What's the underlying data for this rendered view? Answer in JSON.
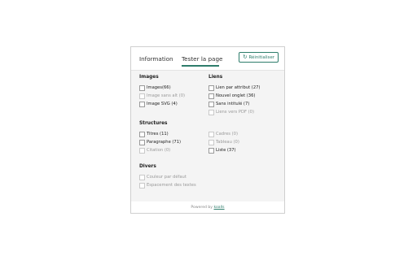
{
  "header": {
    "tabs": [
      {
        "label": "Information"
      },
      {
        "label": "Tester la page"
      }
    ],
    "reset_label": "Réinitialiser"
  },
  "sections": {
    "images": {
      "title": "Images",
      "items": [
        {
          "label": "Images(66)",
          "disabled": false
        },
        {
          "label": "Image sans alt (0)",
          "disabled": true
        },
        {
          "label": "Image SVG (4)",
          "disabled": false
        }
      ]
    },
    "liens": {
      "title": "Liens",
      "items": [
        {
          "label": "Lien par attribut (27)",
          "disabled": false
        },
        {
          "label": "Nouvel onglet (36)",
          "disabled": false
        },
        {
          "label": "Sans intitulé (7)",
          "disabled": false
        },
        {
          "label": "Liens vers PDF (0)",
          "disabled": true
        }
      ]
    },
    "structures": {
      "title": "Structures",
      "items_left": [
        {
          "label": "Titres (11)",
          "disabled": false
        },
        {
          "label": "Paragraphe (71)",
          "disabled": false
        },
        {
          "label": "Citation (0)",
          "disabled": true
        }
      ],
      "items_right": [
        {
          "label": "Cadres (0)",
          "disabled": true
        },
        {
          "label": "Tableau (0)",
          "disabled": true
        },
        {
          "label": "Liste (37)",
          "disabled": false
        }
      ]
    },
    "divers": {
      "title": "Divers",
      "items": [
        {
          "label": "Couleur par défaut",
          "disabled": true
        },
        {
          "label": "Espacement des textes",
          "disabled": true
        }
      ]
    }
  },
  "footer": {
    "prefix": "Powered by",
    "link": "koalls"
  }
}
